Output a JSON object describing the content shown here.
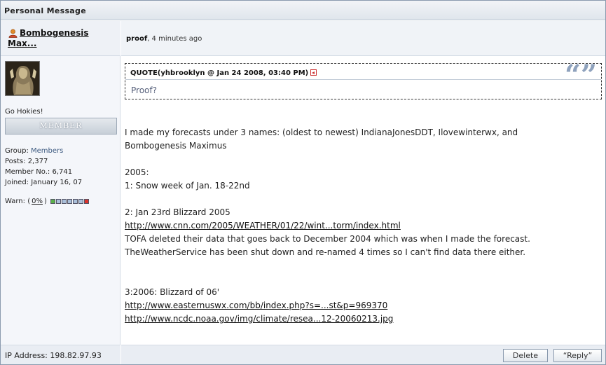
{
  "header": {
    "title": "Personal Message"
  },
  "author": {
    "name": "Bombogenesis Max...",
    "title": "Go Hokies!",
    "rank": "MEMBER",
    "stats": [
      {
        "label": "Group: ",
        "value": "Members",
        "link": true
      },
      {
        "label": "Posts: ",
        "value": "2,377",
        "link": false
      },
      {
        "label": "Member No.: ",
        "value": "6,741",
        "link": false
      },
      {
        "label": "Joined: ",
        "value": "January 16, 07",
        "link": false
      }
    ],
    "warn_label": "Warn: (",
    "warn_pct": "0%",
    "warn_close": ")",
    "ip": "IP Address: 198.82.97.93"
  },
  "post": {
    "subject": "proof",
    "time": ", 4 minutes ago",
    "quote_label": "QUOTE(yhbrooklyn @ Jan 24 2008, 03:40 PM)",
    "quote_marks": "“”",
    "quote_text": "Proof?",
    "line1": "I made my forecasts under 3 names: (oldest to newest) IndianaJonesDDT, Ilovewinterwx, and",
    "line2": "Bombogenesis Maximus",
    "line3": "2005:",
    "line4": "1: Snow week of Jan. 18-22nd",
    "line5": "2: Jan 23rd Blizzard 2005",
    "link1": "http://www.cnn.com/2005/WEATHER/01/22/wint...torm/index.html",
    "line6": "TOFA deleted their data that goes back to December 2004 which was when I made the forecast.",
    "line7": "TheWeatherService has been shut down and re-named 4 times so I can't find data there either.",
    "line8": "3:2006: Blizzard of 06'",
    "link2": "http://www.easternuswx.com/bb/index.php?s=...st&p=969370",
    "link3": "http://www.ncdc.noaa.gov/img/climate/resea...12-20060213.jpg"
  },
  "actions": {
    "delete": "Delete",
    "reply": "“Reply”"
  },
  "colors": {
    "warn_green": "#5ab04a",
    "warn_blue": "#a9bfd9",
    "warn_red": "#d9322c",
    "accent": "#3d5a80"
  }
}
